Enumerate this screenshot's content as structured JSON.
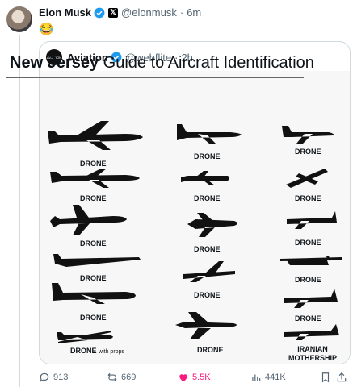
{
  "tweet": {
    "author_name": "Elon Musk",
    "handle": "@elonmusk",
    "time": "6m",
    "text": "😂"
  },
  "quote": {
    "avatar_label": "AVIATION",
    "author_name": "Aviation",
    "handle": "@webflite",
    "time": "2h",
    "image_title_part1": "New Jersey",
    "image_title_part2": "Guide to Aircraft Identification",
    "labels": {
      "c1": [
        "DRONE",
        "DRONE",
        "DRONE",
        "DRONE",
        "DRONE",
        "DRONE"
      ],
      "c1_last_suffix": "with props",
      "c2": [
        "DRONE",
        "DRONE",
        "DRONE",
        "DRONE",
        "DRONE"
      ],
      "c3": [
        "DRONE",
        "DRONE",
        "DRONE",
        "DRONE",
        "DRONE",
        "IRANIAN",
        "MOTHERSHIP"
      ]
    }
  },
  "actions": {
    "replies": "913",
    "reposts": "669",
    "likes": "5.5K",
    "views": "441K"
  },
  "colors": {
    "accent": "#1d9bf0",
    "like": "#f91880",
    "muted": "#536471"
  }
}
